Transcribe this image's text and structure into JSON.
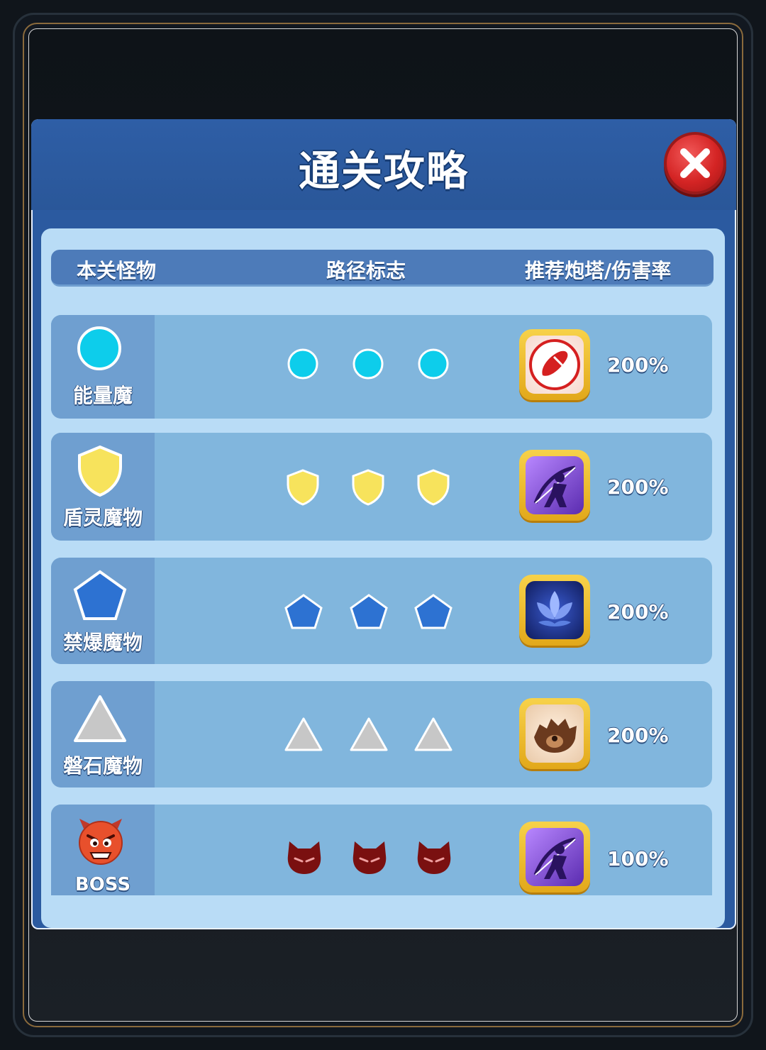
{
  "dialog": {
    "title": "通关攻略",
    "close_icon": "close-x-icon"
  },
  "columns": {
    "monsters": "本关怪物",
    "path_markers": "路径标志",
    "recommended": "推荐炮塔/伤害率"
  },
  "rows": [
    {
      "name": "能量魔",
      "shape": "circle",
      "color": "#0dcdeb",
      "tower_icon": "red-bullet-tower-icon",
      "rate": "200%"
    },
    {
      "name": "盾灵魔物",
      "shape": "shield",
      "color": "#f7e35c",
      "tower_icon": "archer-tower-icon",
      "rate": "200%"
    },
    {
      "name": "禁爆魔物",
      "shape": "pentagon",
      "color": "#2d72d2",
      "tower_icon": "lotus-tower-icon",
      "rate": "200%"
    },
    {
      "name": "磐石魔物",
      "shape": "triangle",
      "color": "#c7c7c7",
      "tower_icon": "beast-tower-icon",
      "rate": "200%"
    },
    {
      "name": "BOSS",
      "shape": "devil",
      "color": "#7a1010",
      "tower_icon": "archer-tower-icon",
      "rate": "100%"
    }
  ]
}
